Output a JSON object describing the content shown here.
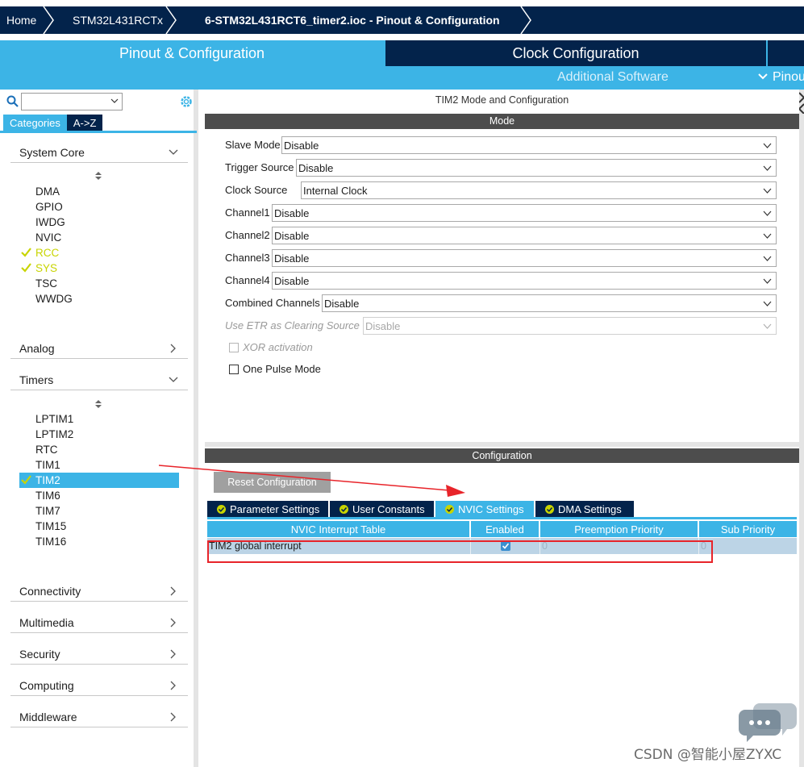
{
  "breadcrumb": {
    "items": [
      "Home",
      "STM32L431RCTx",
      "6-STM32L431RCT6_timer2.ioc - Pinout & Configuration"
    ]
  },
  "main_tabs": {
    "pinout": "Pinout & Configuration",
    "clock": "Clock Configuration",
    "additional_software": "Additional Software",
    "pinout_sub": "Pinout"
  },
  "left_panel": {
    "search_value": "",
    "tabs": {
      "categories": "Categories",
      "az": "A->Z"
    },
    "categories": {
      "system_core": {
        "label": "System Core",
        "items": [
          {
            "label": "DMA"
          },
          {
            "label": "GPIO"
          },
          {
            "label": "IWDG"
          },
          {
            "label": "NVIC"
          },
          {
            "label": "RCC"
          },
          {
            "label": "SYS"
          },
          {
            "label": "TSC"
          },
          {
            "label": "WWDG"
          }
        ]
      },
      "analog": "Analog",
      "timers": {
        "label": "Timers",
        "items": [
          {
            "label": "LPTIM1"
          },
          {
            "label": "LPTIM2"
          },
          {
            "label": "RTC"
          },
          {
            "label": "TIM1"
          },
          {
            "label": "TIM2"
          },
          {
            "label": "TIM6"
          },
          {
            "label": "TIM7"
          },
          {
            "label": "TIM15"
          },
          {
            "label": "TIM16"
          }
        ]
      },
      "connectivity": "Connectivity",
      "multimedia": "Multimedia",
      "security": "Security",
      "computing": "Computing",
      "middleware": "Middleware"
    }
  },
  "mode_panel": {
    "title": "TIM2 Mode and Configuration",
    "section": "Mode",
    "fields": {
      "slave_mode": {
        "label": "Slave Mode",
        "value": "Disable"
      },
      "trigger_source": {
        "label": "Trigger Source",
        "value": "Disable"
      },
      "clock_source": {
        "label": "Clock Source",
        "value": "Internal Clock"
      },
      "channel1": {
        "label": "Channel1",
        "value": "Disable"
      },
      "channel2": {
        "label": "Channel2",
        "value": "Disable"
      },
      "channel3": {
        "label": "Channel3",
        "value": "Disable"
      },
      "channel4": {
        "label": "Channel4",
        "value": "Disable"
      },
      "combined_channels": {
        "label": "Combined Channels",
        "value": "Disable"
      },
      "use_etr": {
        "label": "Use ETR as Clearing Source",
        "value": "Disable"
      }
    },
    "checkboxes": {
      "xor": "XOR activation",
      "one_pulse": "One Pulse Mode"
    }
  },
  "config_panel": {
    "section": "Configuration",
    "reset_button": "Reset Configuration",
    "tabs": {
      "parameter": "Parameter Settings",
      "user_constants": "User Constants",
      "nvic": "NVIC Settings",
      "dma": "DMA Settings"
    },
    "table": {
      "headers": [
        "NVIC Interrupt Table",
        "Enabled",
        "Preemption Priority",
        "Sub Priority"
      ],
      "row": {
        "name": "TIM2 global interrupt",
        "preemption": "0",
        "sub": "0"
      }
    }
  },
  "watermark": "CSDN @智能小屋ZYXC",
  "colors": {
    "navy": "#03234b",
    "accent_blue": "#3cb4e6",
    "check_green": "#c8d400",
    "annotation_red": "#e8242a"
  }
}
